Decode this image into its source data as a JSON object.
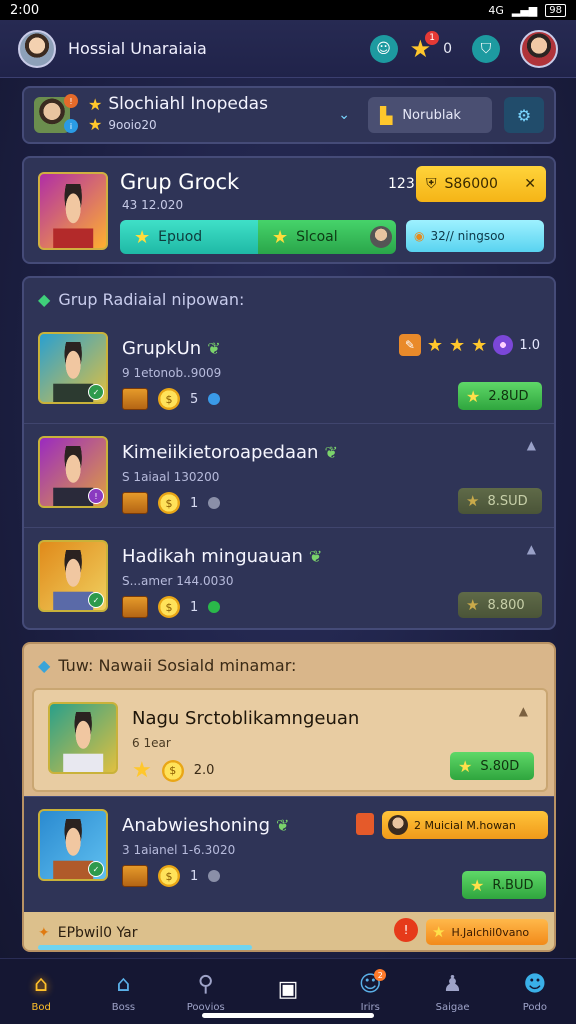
{
  "status": {
    "time": "2:00",
    "signal": "4G",
    "battery": "98"
  },
  "header": {
    "title": "Hossial Unaraiaia",
    "star_count": "0",
    "star_badge": "1"
  },
  "profile": {
    "name": "Slochiahl Inopedas",
    "sub": "9ooio20",
    "button_label": "Norublak"
  },
  "group": {
    "title": "Grup Grock",
    "sub": "43 12.020",
    "number": "123",
    "gold_label": "S86000",
    "tab_a": "Epuod",
    "tab_b": "Slcoal",
    "cyan_label": "32// ningsoo"
  },
  "list": {
    "heading": "Grup Radiaial nipowan:",
    "rows": [
      {
        "title": "GrupkUn",
        "sub": "9 1etonob..9009",
        "count": "5",
        "rating": "1.0",
        "button": "2.8UD"
      },
      {
        "title": "Kimeiikietoroapedaan",
        "sub": "S 1aiaal 130200",
        "count": "1",
        "button": "8.SUD"
      },
      {
        "title": "Hadikah minguauan",
        "sub": "S...amer 144.0030",
        "count": "1",
        "button": "8.800"
      }
    ]
  },
  "tan": {
    "heading": "Tuw: Nawaii Sosiald minamar:",
    "row": {
      "title": "Nagu Srctoblikamngeuan",
      "sub": "6 1ear",
      "count": "2.0",
      "button": "S.80D"
    },
    "lower": {
      "title": "Anabwieshoning",
      "sub": "3 1aianel 1-6.3020",
      "count": "1",
      "pill": "2 Muicial M.howan",
      "button": "R.BUD"
    },
    "bottom": {
      "text": "EPbwil0 Yar",
      "pill": "H.Jalchil0vano"
    }
  },
  "nav": [
    {
      "label": "Bod",
      "icon": "home-icon"
    },
    {
      "label": "Boss",
      "icon": "house-icon"
    },
    {
      "label": "Poovios",
      "icon": "search-icon"
    },
    {
      "label": "",
      "icon": "square-icon"
    },
    {
      "label": "Irirs",
      "icon": "chat-icon"
    },
    {
      "label": "Saigae",
      "icon": "people-icon"
    },
    {
      "label": "Podo",
      "icon": "profile-icon"
    }
  ]
}
